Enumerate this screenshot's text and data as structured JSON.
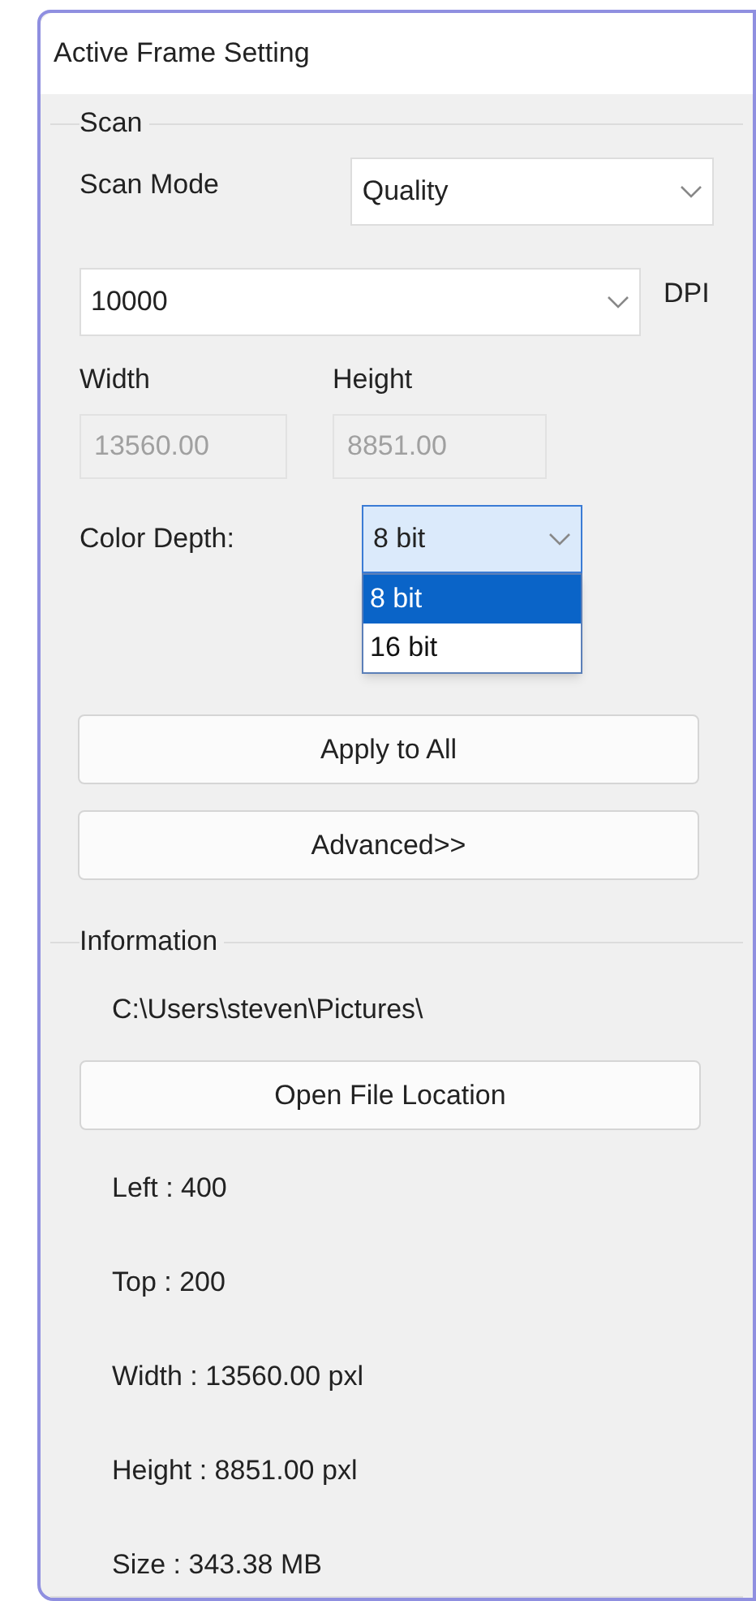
{
  "window": {
    "title": "Active Frame Setting"
  },
  "scan": {
    "title": "Scan",
    "scan_mode": {
      "label": "Scan Mode",
      "value": "Quality"
    },
    "dpi": {
      "value": "10000",
      "unit": "DPI"
    },
    "width": {
      "label": "Width",
      "value": "13560.00",
      "disabled": true
    },
    "height": {
      "label": "Height",
      "value": "8851.00",
      "disabled": true
    },
    "color_depth": {
      "label": "Color Depth:",
      "value": "8 bit",
      "expanded": true,
      "options": [
        {
          "label": "8 bit",
          "selected": true
        },
        {
          "label": "16 bit",
          "selected": false
        }
      ]
    }
  },
  "buttons": [
    "Apply to All",
    "Advanced>>"
  ],
  "information": {
    "title": "Information",
    "path": "C:\\Users\\steven\\Pictures\\",
    "open_button": "Open File Location",
    "lines": [
      "Left : 400",
      "Top : 200",
      "Width : 13560.00 pxl",
      "Height : 8851.00 pxl",
      "Size : 343.38 MB"
    ]
  }
}
